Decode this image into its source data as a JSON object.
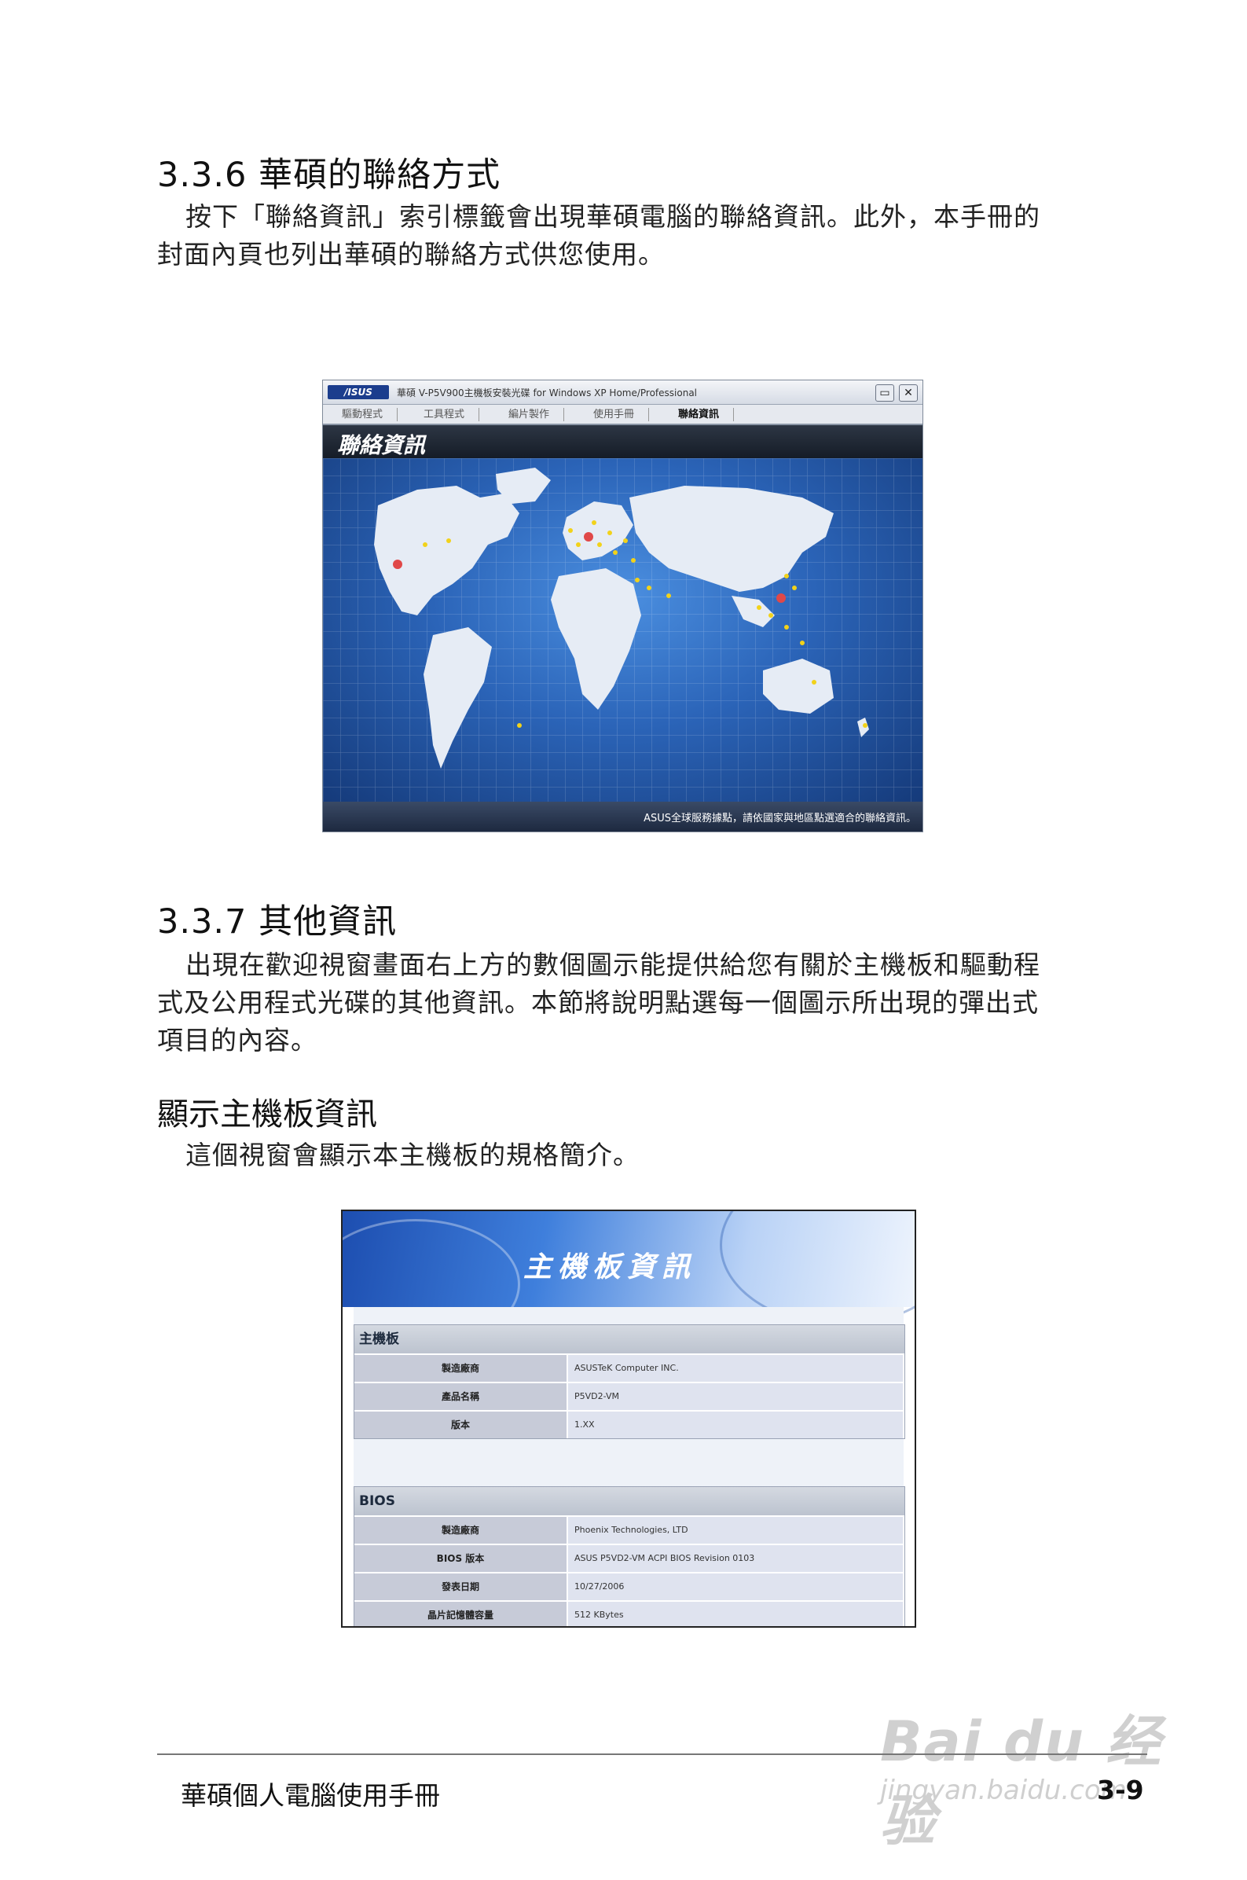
{
  "section1": {
    "heading": "3.3.6 華碩的聯絡方式",
    "para_lines": [
      "按下「聯絡資訊」索引標籤會出現華碩電腦的聯絡資訊。此外，本手冊的",
      "封面內頁也列出華碩的聯絡方式供您使用。"
    ]
  },
  "contact_window": {
    "logo": "/ISUS",
    "title": "華碩 V-P5V900主機板安裝光碟 for Windows XP Home/Professional",
    "minimize_icon": "minimize-icon",
    "close_icon": "close-icon",
    "minimize_glyph": "▭",
    "close_glyph": "✕",
    "tabs": [
      "驅動程式",
      "工具程式",
      "編片製作",
      "使用手冊",
      "聯絡資訊"
    ],
    "active_tab": "聯絡資訊",
    "header": "聯絡資訊",
    "footer_text": "ASUS全球服務據點，請依國家與地區點選適合的聯絡資訊。",
    "colors": {
      "map_bg": "#2b64b8",
      "land": "#e8eef6",
      "dot": "#f2d21a",
      "hq_dot": "#e04848"
    }
  },
  "section2": {
    "heading": "3.3.7 其他資訊",
    "para_lines": [
      "出現在歡迎視窗畫面右上方的數個圖示能提供給您有關於主機板和驅動程",
      "式及公用程式光碟的其他資訊。本節將說明點選每一個圖示所出現的彈出式",
      "項目的內容。"
    ]
  },
  "subsection": {
    "heading": "顯示主機板資訊",
    "para": "這個視窗會顯示本主機板的規格簡介。"
  },
  "mb_window": {
    "banner_title": "主機板資訊",
    "groups": [
      {
        "title": "主機板",
        "rows": [
          {
            "label": "製造廠商",
            "value": "ASUSTeK Computer INC."
          },
          {
            "label": "產品名稱",
            "value": "P5VD2-VM"
          },
          {
            "label": "版本",
            "value": "1.XX"
          }
        ]
      },
      {
        "title": "BIOS",
        "rows": [
          {
            "label": "製造廠商",
            "value": "Phoenix Technologies, LTD"
          },
          {
            "label": "BIOS 版本",
            "value": "ASUS P5VD2-VM ACPI BIOS Revision 0103"
          },
          {
            "label": "發表日期",
            "value": "10/27/2006"
          },
          {
            "label": "晶片記憶體容量",
            "value": "512 KBytes"
          }
        ]
      }
    ]
  },
  "footer": {
    "title": "華碩個人電腦使用手冊",
    "page": "3-9"
  },
  "watermark": {
    "logo": "Bai du 经验",
    "url": "jingyan.baidu.com"
  }
}
